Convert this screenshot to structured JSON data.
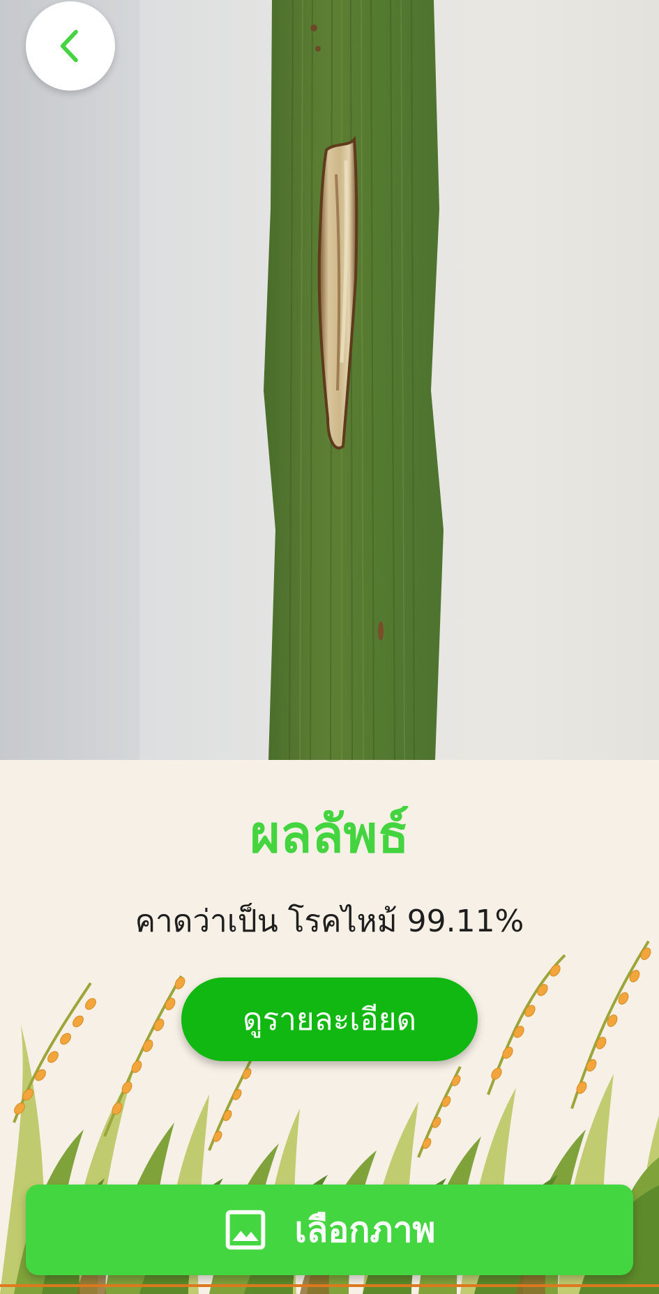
{
  "header": {
    "back_icon": "chevron-left-icon"
  },
  "result": {
    "title": "ผลลัพธ์",
    "prediction_text": "คาดว่าเป็น โรคไหม้ 99.11%"
  },
  "actions": {
    "detail_button_label": "ดูรายละเอียด",
    "choose_image_label": "เลือกภาพ",
    "choose_image_icon": "image-icon"
  },
  "colors": {
    "title_green": "#43d43f",
    "detail_button_green": "#11b811",
    "choose_button_green": "#44d641",
    "background_cream": "#f6f0e6"
  }
}
